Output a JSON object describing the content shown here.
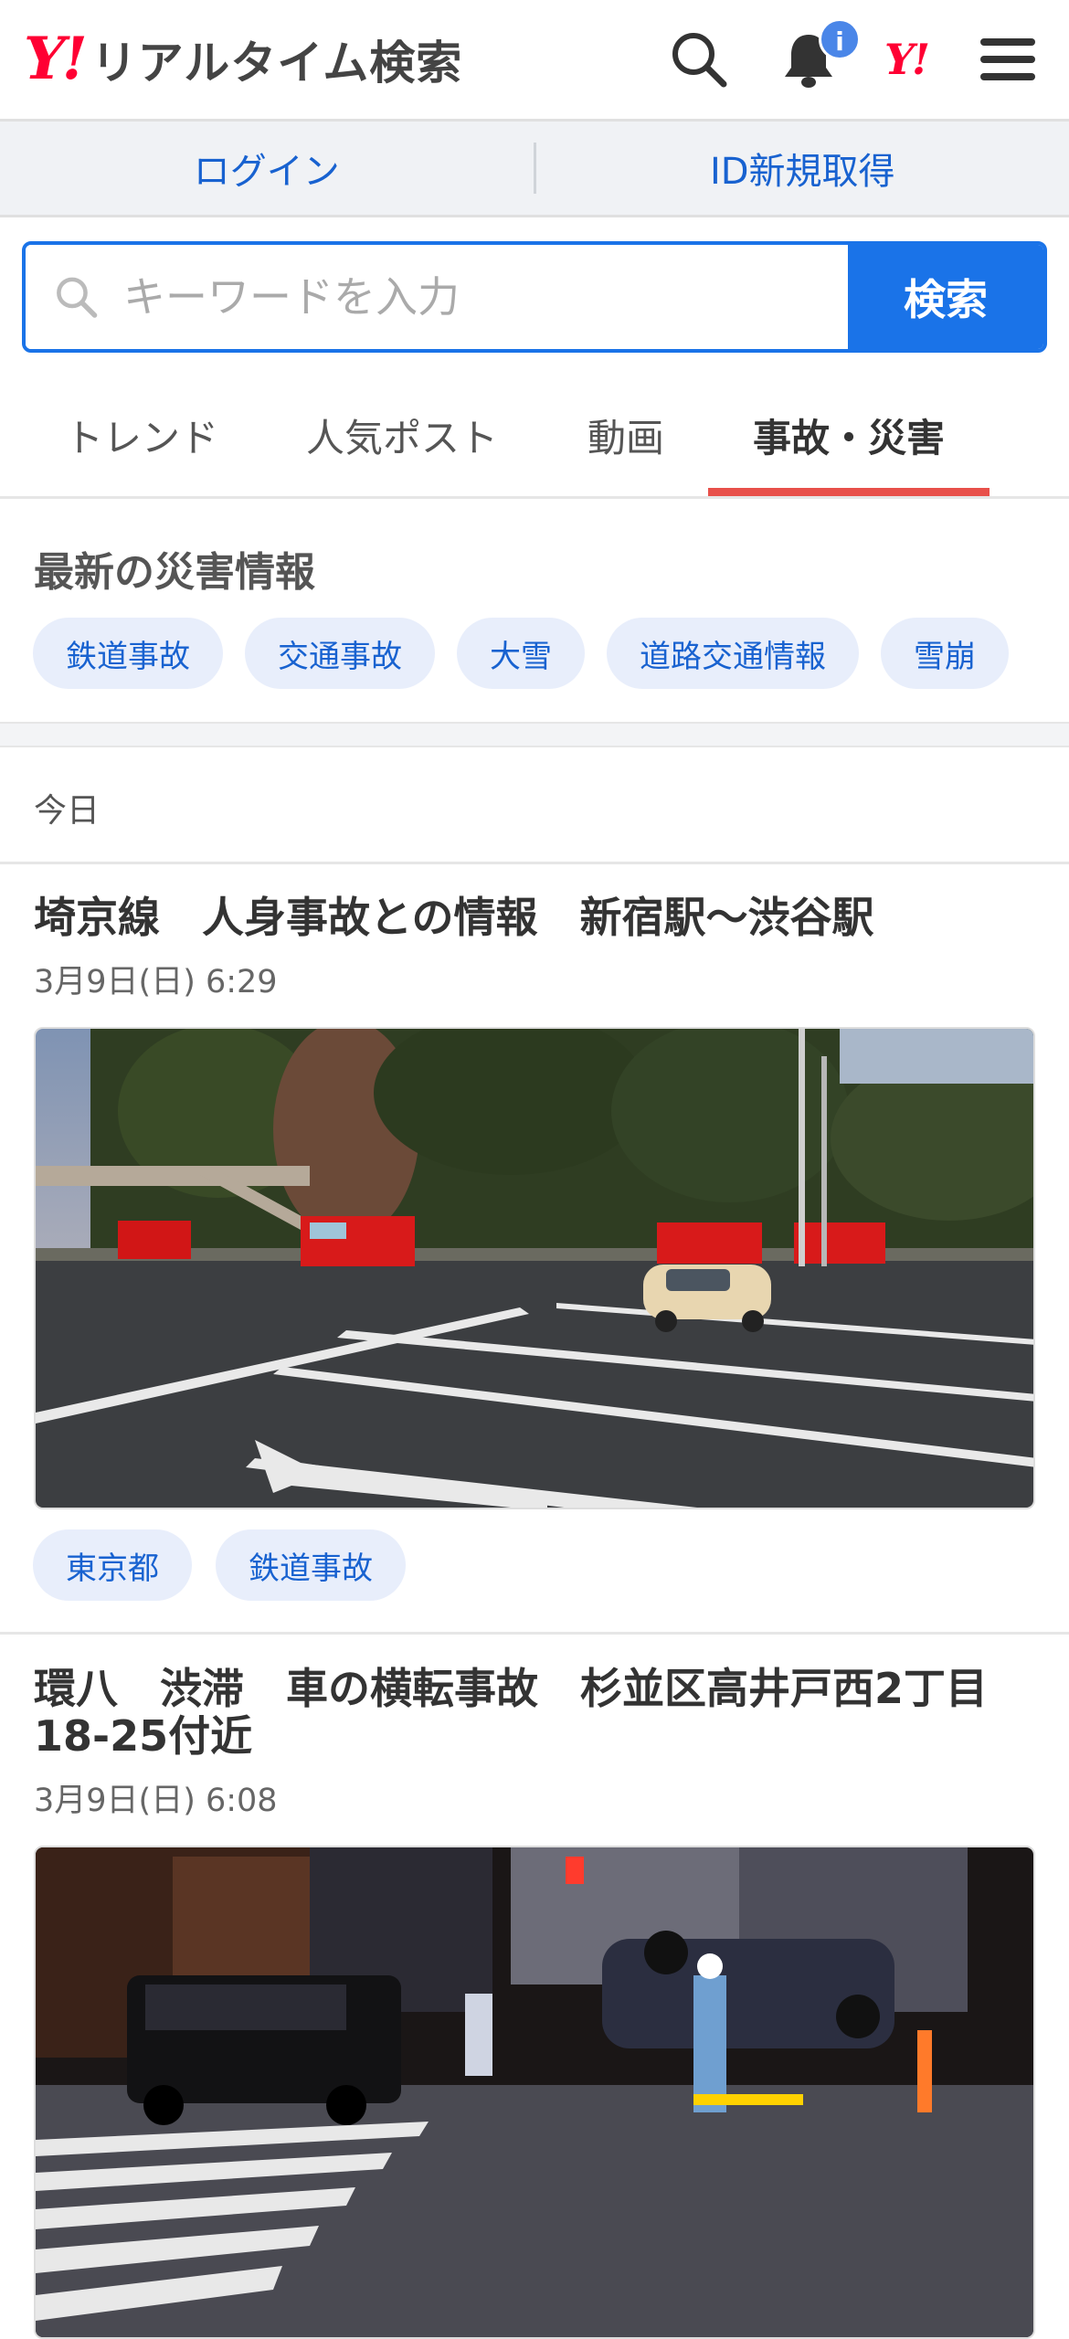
{
  "header": {
    "brand_logo": "Y!",
    "brand_name": "リアルタイム検索",
    "badge": "i",
    "yahoo_logo": "Y!",
    "icons": [
      "search-icon",
      "bell-icon",
      "yahoo-logo",
      "menu-icon"
    ]
  },
  "auth": {
    "login": "ログイン",
    "register": "ID新規取得"
  },
  "search": {
    "placeholder": "キーワードを入力",
    "button": "検索"
  },
  "tabs": [
    {
      "label": "トレンド",
      "active": false
    },
    {
      "label": "人気ポスト",
      "active": false
    },
    {
      "label": "動画",
      "active": false
    },
    {
      "label": "事故・災害",
      "active": true
    }
  ],
  "disaster": {
    "title": "最新の災害情報",
    "chips": [
      "鉄道事故",
      "交通事故",
      "大雪",
      "道路交通情報",
      "雪崩"
    ]
  },
  "date_heading": "今日",
  "articles": [
    {
      "title": "埼京線　人身事故との情報　新宿駅〜渋谷駅",
      "time": "3月9日(日) 6:29",
      "tags": [
        "東京都",
        "鉄道事故"
      ]
    },
    {
      "title": "環八　渋滞　車の横転事故　杉並区高井戸西2丁目18-25付近",
      "time": "3月9日(日) 6:08"
    }
  ],
  "colors": {
    "accent_blue": "#1a73e8",
    "link_blue": "#1862d0",
    "yahoo_red": "#ff0033",
    "tab_underline": "#e8504a",
    "chip_bg": "#e8eefb"
  }
}
